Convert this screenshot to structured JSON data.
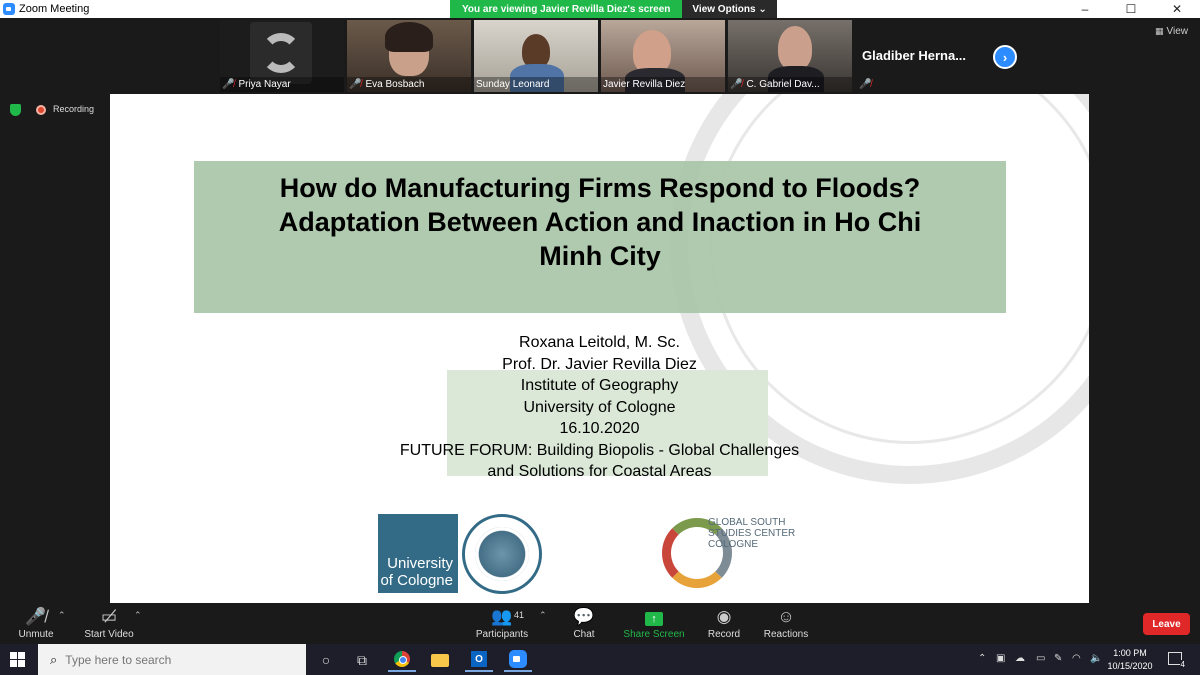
{
  "window": {
    "title": "Zoom Meeting",
    "viewing_banner": "You are viewing Javier Revilla Diez's screen",
    "view_options": "View Options ⌄",
    "controls": {
      "minimize": "–",
      "maximize": "☐",
      "close": "✕"
    }
  },
  "participants": [
    {
      "name": "Priya Nayar"
    },
    {
      "name": "Eva Bosbach"
    },
    {
      "name": "Sunday Leonard"
    },
    {
      "name": "Javier Revilla Diez"
    },
    {
      "name": "C. Gabriel Dav..."
    }
  ],
  "name_only_tile": {
    "name": "Gladiber  Herna..."
  },
  "view_button": "View",
  "recording_label": "Recording",
  "slide": {
    "title_lines": [
      "How do Manufacturing Firms Respond to Floods?",
      "Adaptation Between Action and Inaction in Ho Chi",
      "Minh City"
    ],
    "authors": [
      "Roxana Leitold, M. Sc.",
      "Prof. Dr. Javier Revilla Diez",
      "Institute of Geography",
      "University of Cologne",
      "16.10.2020",
      "FUTURE FORUM: Building Biopolis - Global Challenges",
      "and Solutions for Coastal Areas"
    ],
    "uoc_logo": [
      "University",
      "of Cologne"
    ],
    "gssc_logo": [
      "GLOBAL SOUTH",
      "STUDIES CENTER",
      "COLOGNE"
    ]
  },
  "toolbar": {
    "unmute": "Unmute",
    "start_video": "Start Video",
    "participants": "Participants",
    "participant_count": "41",
    "chat": "Chat",
    "share_screen": "Share Screen",
    "record": "Record",
    "reactions": "Reactions",
    "leave": "Leave"
  },
  "taskbar": {
    "search_placeholder": "Type here to search",
    "time": "1:00 PM",
    "date": "10/15/2020",
    "notification_count": "4"
  }
}
